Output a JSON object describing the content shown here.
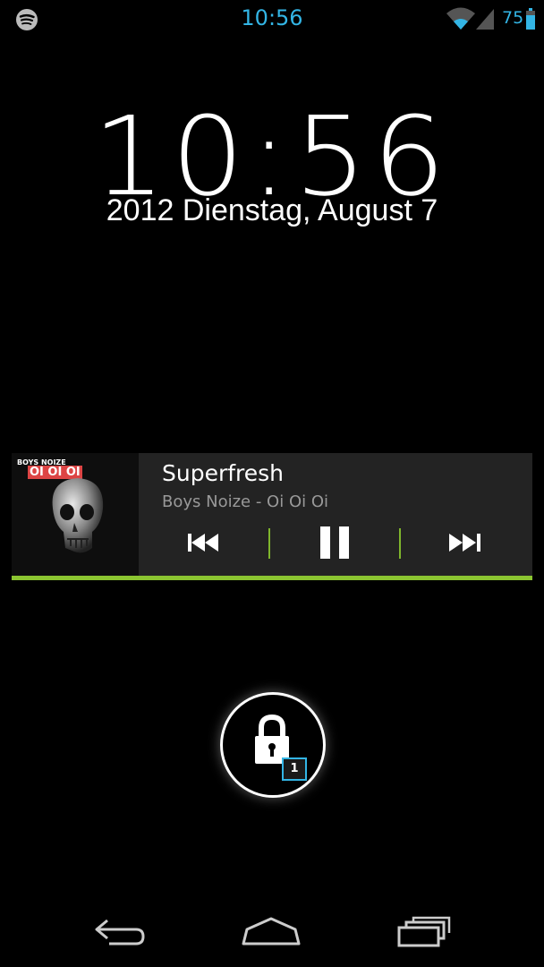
{
  "status_bar": {
    "time": "10:56",
    "battery_percent": "75",
    "icons": [
      "spotify-icon",
      "wifi-icon",
      "signal-icon",
      "battery-icon"
    ],
    "accent_color": "#33b5e5"
  },
  "lockscreen": {
    "clock": "10:56",
    "date": "2012 Dienstag, August 7"
  },
  "music_widget": {
    "album_brand": "BOYS NOIZE",
    "album_logo": "OI OI OI",
    "title": "Superfresh",
    "artist_album": "Boys Noize - Oi Oi Oi",
    "controls": [
      "previous-icon",
      "pause-icon",
      "next-icon"
    ],
    "accent_color": "#8bc531"
  },
  "unlock": {
    "notification_count": "1",
    "icon": "lock-icon"
  },
  "nav_bar": {
    "buttons": [
      "back-icon",
      "home-icon",
      "recent-apps-icon"
    ]
  }
}
